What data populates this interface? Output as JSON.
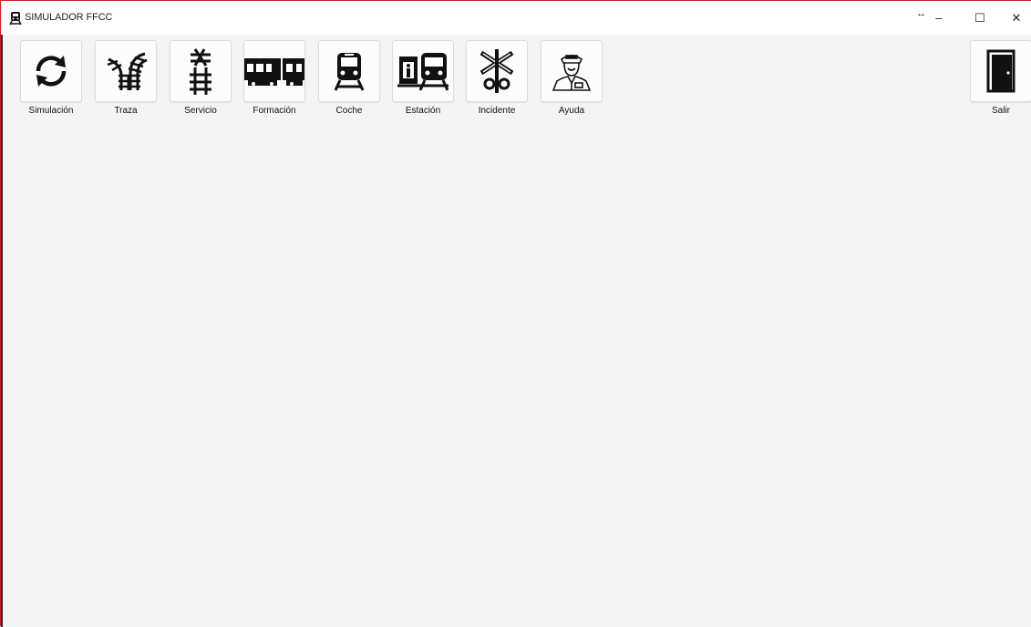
{
  "window": {
    "title": "SIMULADOR FFCC",
    "app_icon": "train-icon",
    "controls": {
      "resize_hint": "↔",
      "minimize": "–",
      "maximize": "☐",
      "close": "✕"
    }
  },
  "toolbar": {
    "items": [
      {
        "id": "simulacion",
        "label": "Simulación",
        "icon": "refresh-icon"
      },
      {
        "id": "traza",
        "label": "Traza",
        "icon": "curved-track-icon"
      },
      {
        "id": "servicio",
        "label": "Servicio",
        "icon": "track-icon"
      },
      {
        "id": "formacion",
        "label": "Formación",
        "icon": "train-cars-icon"
      },
      {
        "id": "coche",
        "label": "Coche",
        "icon": "train-front-icon"
      },
      {
        "id": "estacion",
        "label": "Estación",
        "icon": "station-icon"
      },
      {
        "id": "incidente",
        "label": "Incidente",
        "icon": "railroad-crossing-icon"
      },
      {
        "id": "ayuda",
        "label": "Ayuda",
        "icon": "conductor-icon"
      }
    ],
    "exit": {
      "label": "Salir",
      "icon": "door-icon"
    }
  }
}
